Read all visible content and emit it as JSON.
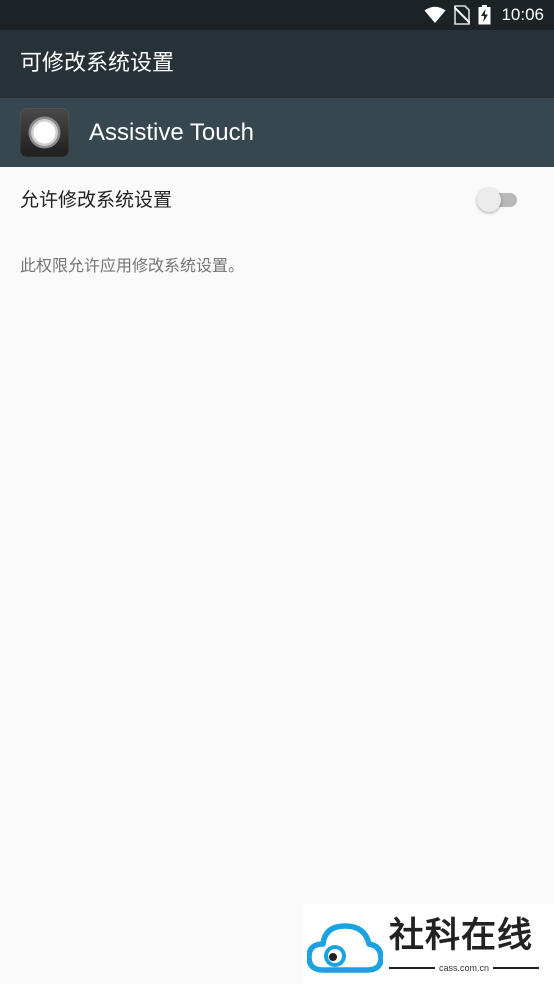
{
  "status_bar": {
    "time": "10:06",
    "icons": [
      "wifi-icon",
      "no-sim-icon",
      "battery-charging-icon"
    ],
    "background": "#1b2327"
  },
  "toolbar": {
    "title": "可修改系统设置",
    "background": "#273238"
  },
  "app": {
    "name": "Assistive Touch",
    "icon": "assistive-touch-app-icon",
    "header_background": "#37474f"
  },
  "setting": {
    "label": "允许修改系统设置",
    "enabled": false,
    "description": "此权限允许应用修改系统设置。"
  },
  "watermark": {
    "title": "社科在线",
    "subtitle": "cass.com.cn",
    "logo": "cloud-eye-logo-icon",
    "logo_color": "#1aa3e0"
  }
}
